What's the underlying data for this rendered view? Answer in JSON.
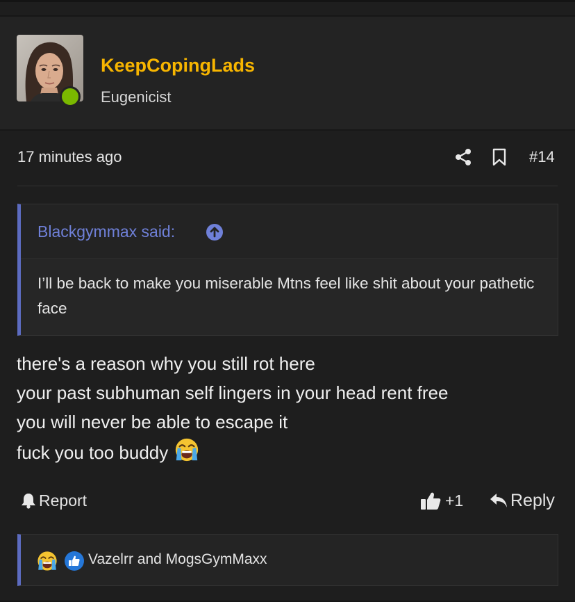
{
  "user": {
    "username": "KeepCopingLads",
    "title": "Eugenicist",
    "online": true
  },
  "post": {
    "timestamp": "17 minutes ago",
    "number": "#14",
    "share_icon": "share-icon",
    "bookmark_icon": "bookmark-icon"
  },
  "quote": {
    "author_label": "Blackgymmax said:",
    "jump_icon": "arrow-up-circle-icon",
    "body": "I’ll be back to make you miserable Mtns feel like shit about your pathetic face"
  },
  "message": {
    "lines": [
      "there's a reason why you still rot here",
      "your past subhuman self lingers in your head rent free",
      "you will never be able to escape it",
      "fuck you too buddy"
    ],
    "trailing_emoji": "loudly-crying-face"
  },
  "actions": {
    "report_label": "Report",
    "like_count": "+1",
    "reply_label": "Reply"
  },
  "reactions": {
    "icons": [
      "loudly-crying-face-icon",
      "like-icon"
    ],
    "names": "Vazelrr and MogsGymMaxx"
  },
  "colors": {
    "username": "#f7b500",
    "quote_accent": "#5c6bc0",
    "quote_author": "#6f80d8",
    "online": "#7ab800",
    "like_badge": "#2577d8"
  }
}
